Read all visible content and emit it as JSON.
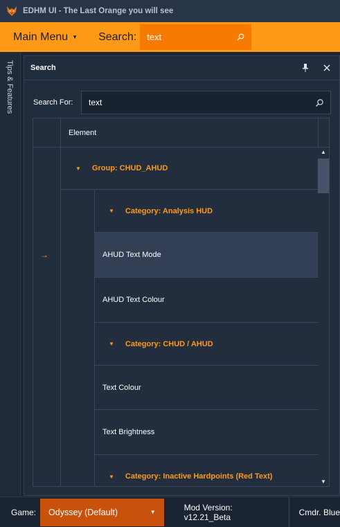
{
  "window": {
    "title": "EDHM UI - The Last Orange you will see"
  },
  "menubar": {
    "main_menu_label": "Main Menu",
    "search_label": "Search:",
    "search_value": "text"
  },
  "side_tab": {
    "label": "Tips & Features"
  },
  "search_panel": {
    "title": "Search",
    "search_for_label": "Search For:",
    "search_value": "text",
    "column_header": "Element",
    "rows": [
      {
        "kind": "group",
        "label": "Group: CHUD_AHUD"
      },
      {
        "kind": "category",
        "label": "Category: Analysis HUD"
      },
      {
        "kind": "item",
        "label": "AHUD Text Mode",
        "selected": true
      },
      {
        "kind": "item",
        "label": "AHUD Text Colour"
      },
      {
        "kind": "category",
        "label": "Category: CHUD / AHUD"
      },
      {
        "kind": "item",
        "label": "Text Colour"
      },
      {
        "kind": "item",
        "label": "Text Brightness"
      },
      {
        "kind": "category",
        "label": "Category: Inactive Hardpoints (Red Text)"
      }
    ]
  },
  "statusbar": {
    "game_label": "Game:",
    "game_value": "Odyssey (Default)",
    "mod_version": "Mod Version: v12.21_Beta",
    "cmdr": "Cmdr. Blue"
  },
  "colors": {
    "accent": "#ff9a16",
    "accent_dark": "#f77a05",
    "game_select": "#c8520c",
    "background": "#1b2433",
    "panel": "#212c3d",
    "selected_row": "#323f55"
  },
  "icons": {
    "app": "orange-fox-logo",
    "menu_caret": "caret-down-icon",
    "search": "magnifier-icon",
    "pin": "pin-icon",
    "close": "close-icon",
    "chevron": "chevron-down-icon",
    "row_indicator": "arrow-right-icon",
    "scroll_up": "scroll-up-icon",
    "scroll_down": "scroll-down-icon"
  }
}
